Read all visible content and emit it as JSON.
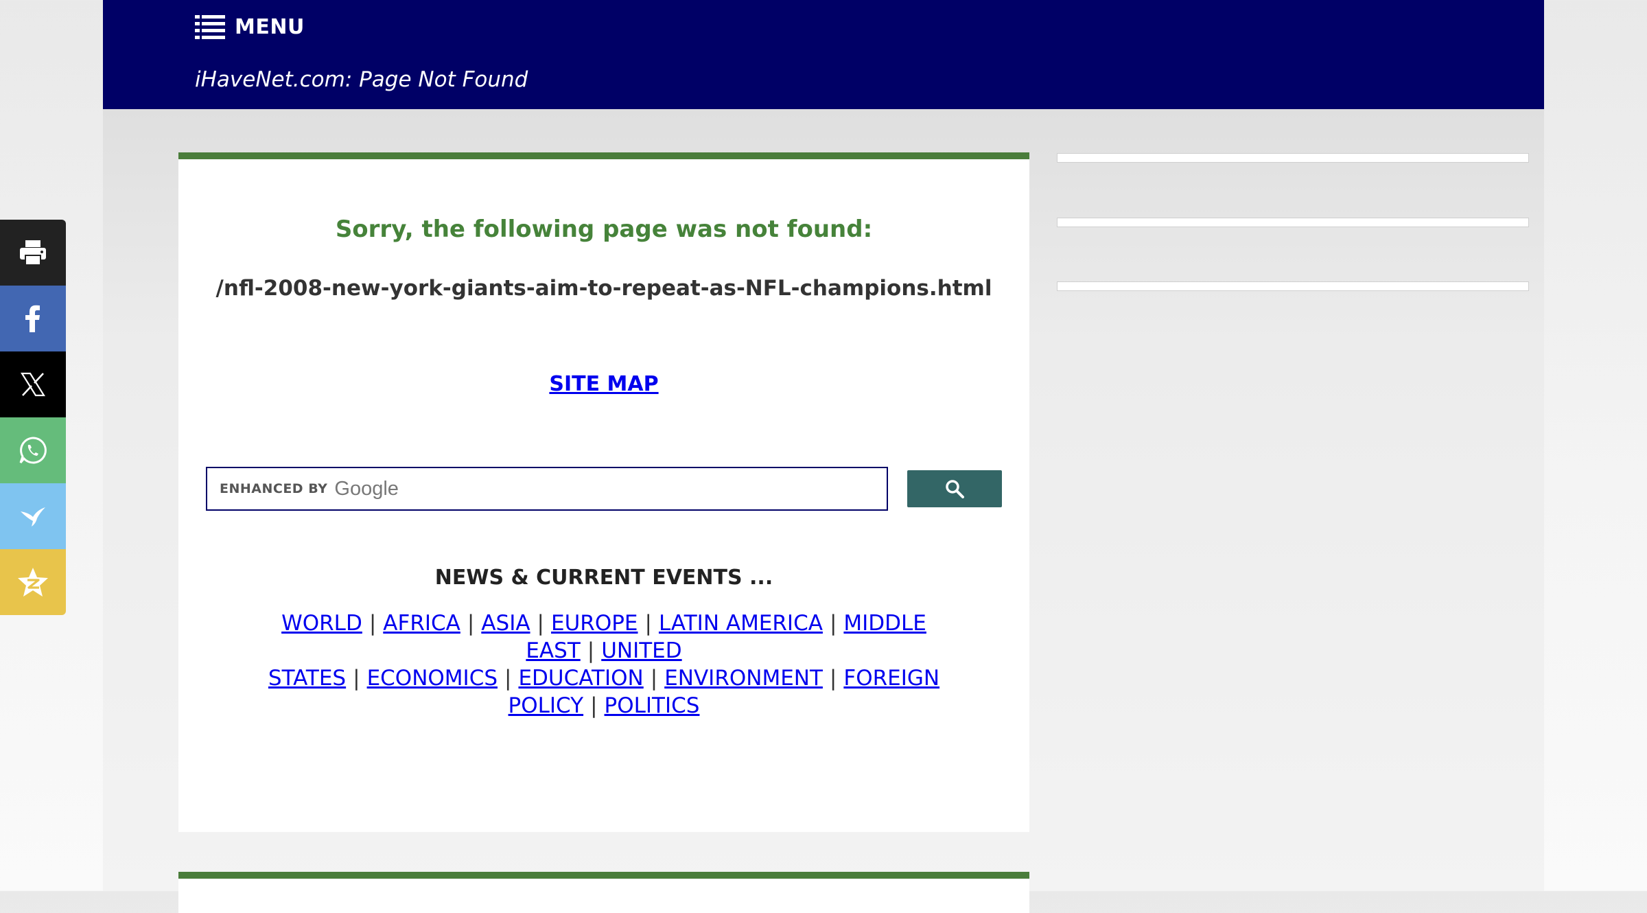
{
  "header": {
    "menu_label": "MENU",
    "site_title": "iHaveNet.com: Page Not Found",
    "background_color": "#000066"
  },
  "main": {
    "heading": "Sorry, the following page was not found:",
    "missing_path": "/nfl-2008-new-york-giants-aim-to-repeat-as-NFL-champions.html",
    "sitemap_link": "SITE MAP",
    "accent_color": "#4a7d3b",
    "heading_color": "#46833a"
  },
  "search": {
    "brand_small": "ENHANCED BY",
    "brand_google": "Google",
    "value": "",
    "button_icon": "search-icon",
    "button_color": "#336666"
  },
  "news": {
    "heading": "NEWS & CURRENT EVENTS ...",
    "links": [
      "WORLD",
      "AFRICA",
      "ASIA",
      "EUROPE",
      "LATIN AMERICA",
      "MIDDLE EAST",
      "UNITED STATES",
      "ECONOMICS",
      "EDUCATION",
      "ENVIRONMENT",
      "FOREIGN POLICY",
      "POLITICS"
    ],
    "separator": "|"
  },
  "share_bar": [
    {
      "name": "print",
      "icon": "print-icon",
      "color": "#222222"
    },
    {
      "name": "facebook",
      "icon": "facebook-icon",
      "color": "#4267b2"
    },
    {
      "name": "x",
      "icon": "x-icon",
      "color": "#000000"
    },
    {
      "name": "whatsapp",
      "icon": "whatsapp-icon",
      "color": "#65bc7b"
    },
    {
      "name": "hummingbird",
      "icon": "hummingbird-icon",
      "color": "#7fc4f0"
    },
    {
      "name": "qzone",
      "icon": "qzone-icon",
      "color": "#e8c44b"
    }
  ]
}
